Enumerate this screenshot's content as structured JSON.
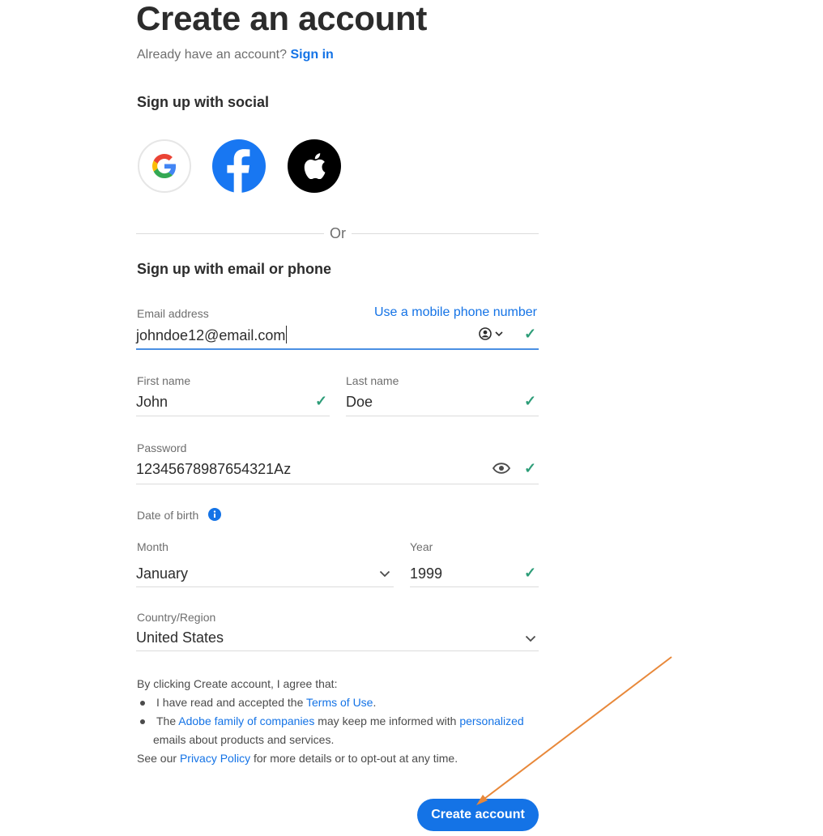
{
  "header": {
    "title": "Create an account",
    "have_account_text": "Already have an account?",
    "sign_in_link": "Sign in"
  },
  "social": {
    "heading": "Sign up with social",
    "providers": [
      "Google",
      "Facebook",
      "Apple"
    ],
    "or_divider": "Or"
  },
  "email_section": {
    "heading": "Sign up with email or phone",
    "use_phone_link": "Use a mobile phone number",
    "email_label": "Email address",
    "email_value": "johndoe12@email.com",
    "first_name_label": "First name",
    "first_name_value": "John",
    "last_name_label": "Last name",
    "last_name_value": "Doe",
    "password_label": "Password",
    "password_value": "12345678987654321Az",
    "dob_label": "Date of birth",
    "month_label": "Month",
    "month_value": "January",
    "year_label": "Year",
    "year_value": "1999",
    "country_label": "Country/Region",
    "country_value": "United States"
  },
  "legal": {
    "intro": "By clicking Create account, I agree that:",
    "bullet1_prefix": "I have read and accepted the",
    "terms_link": "Terms of Use",
    "bullet1_suffix": ".",
    "bullet2_prefix": "The",
    "adobe_family_link": "Adobe family of companies",
    "bullet2_middle": "may keep me informed with",
    "personalized_link": "personalized",
    "bullet2_line2": "emails about products and services.",
    "see_our": "See our",
    "privacy_link": "Privacy Policy",
    "privacy_suffix": "for more details or to opt-out at any time."
  },
  "create_button": "Create account",
  "colors": {
    "accent": "#1473e6",
    "check": "#2d9d78",
    "annotation_arrow": "#e8883a",
    "facebook": "#1877f2"
  },
  "icons": {
    "check": "✓",
    "check_name": "check-icon",
    "chevron_name": "chevron-down-icon",
    "eye_name": "eye-icon",
    "info_name": "info-icon",
    "account_name": "account-circle-icon"
  }
}
